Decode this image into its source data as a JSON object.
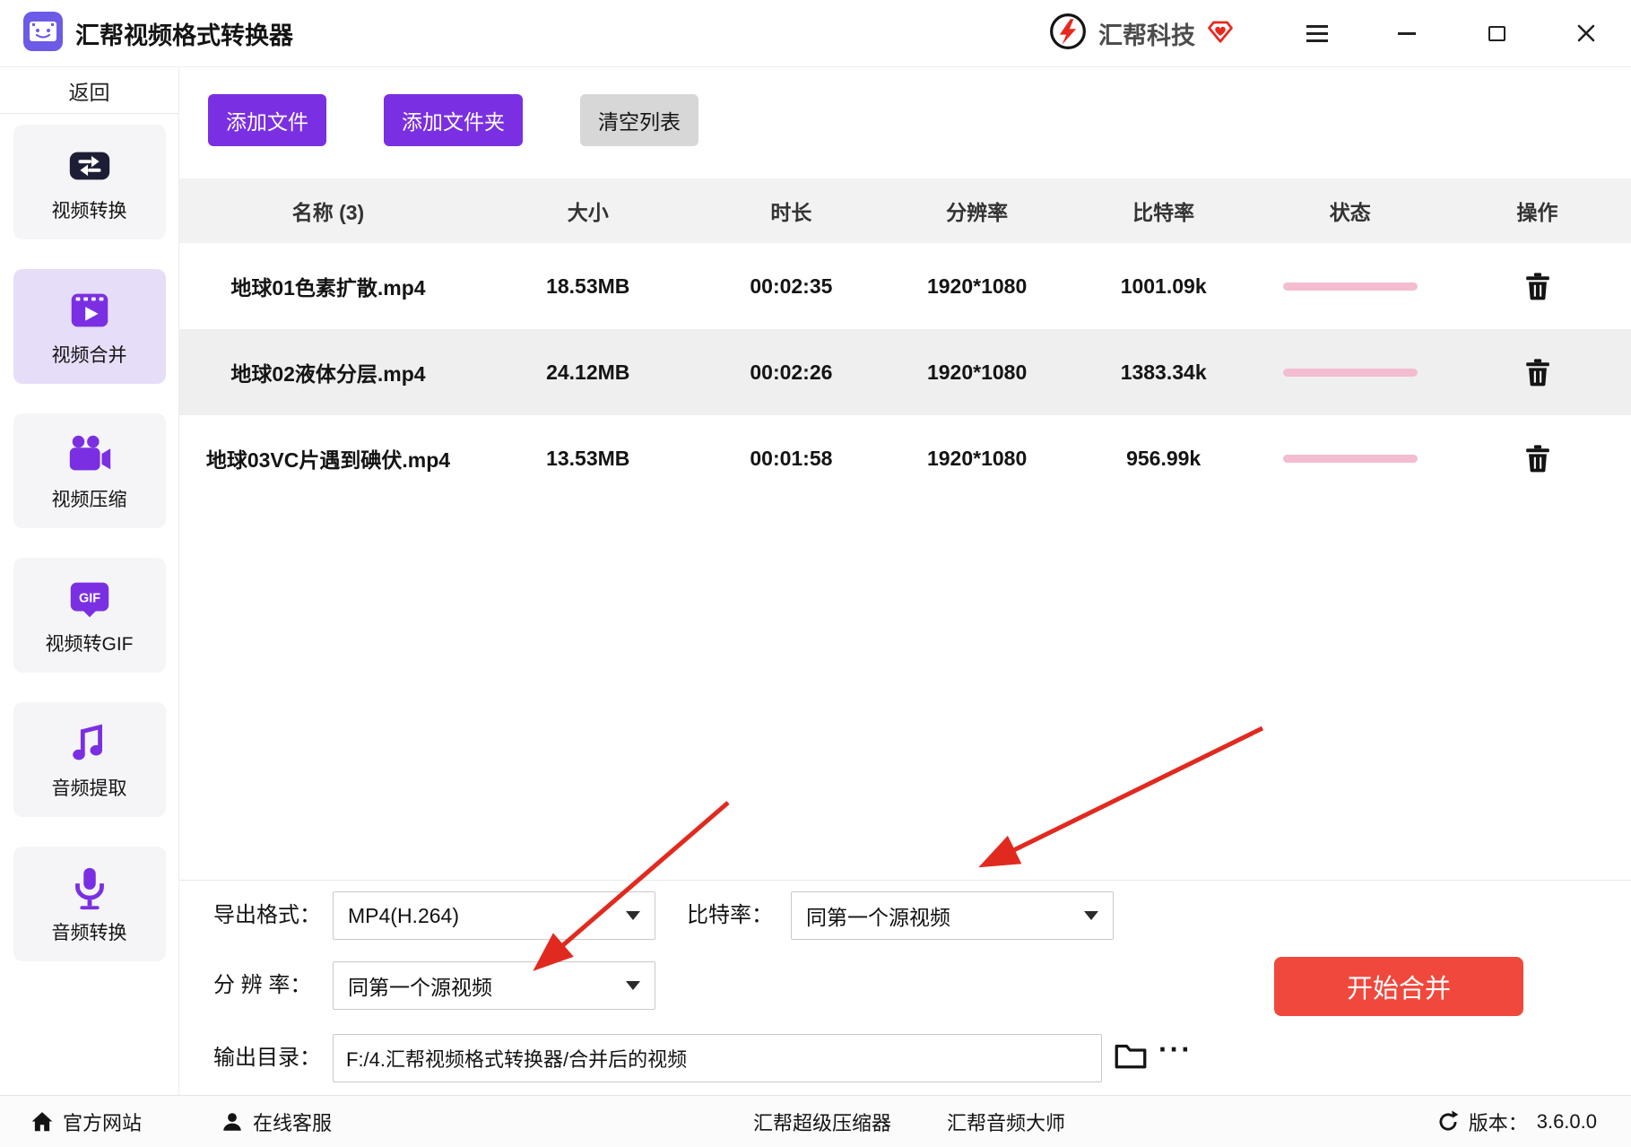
{
  "titlebar": {
    "app_title": "汇帮视频格式转换器",
    "brand_name": "汇帮科技"
  },
  "sidebar": {
    "back": "返回",
    "items": [
      {
        "label": "视频转换",
        "icon": "video-convert-icon",
        "active": false
      },
      {
        "label": "视频合并",
        "icon": "video-merge-icon",
        "active": true
      },
      {
        "label": "视频压缩",
        "icon": "video-compress-icon",
        "active": false
      },
      {
        "label": "视频转GIF",
        "icon": "video-to-gif-icon",
        "active": false
      },
      {
        "label": "音频提取",
        "icon": "audio-extract-icon",
        "active": false
      },
      {
        "label": "音频转换",
        "icon": "audio-convert-icon",
        "active": false
      }
    ]
  },
  "toolbar": {
    "add_file": "添加文件",
    "add_folder": "添加文件夹",
    "clear_list": "清空列表"
  },
  "table": {
    "headers": [
      "名称 (3)",
      "大小",
      "时长",
      "分辨率",
      "比特率",
      "状态",
      "操作"
    ],
    "rows": [
      {
        "name": "地球01色素扩散.mp4",
        "size": "18.53MB",
        "duration": "00:02:35",
        "resolution": "1920*1080",
        "bitrate": "1001.09k"
      },
      {
        "name": "地球02液体分层.mp4",
        "size": "24.12MB",
        "duration": "00:02:26",
        "resolution": "1920*1080",
        "bitrate": "1383.34k"
      },
      {
        "name": "地球03VC片遇到碘伏.mp4",
        "size": "13.53MB",
        "duration": "00:01:58",
        "resolution": "1920*1080",
        "bitrate": "956.99k"
      }
    ]
  },
  "settings": {
    "export_format": {
      "label": "导出格式：",
      "value": "MP4(H.264)"
    },
    "bitrate": {
      "label": "比特率：",
      "value": "同第一个源视频"
    },
    "resolution": {
      "label": "分 辨 率：",
      "value": "同第一个源视频"
    },
    "output_dir": {
      "label": "输出目录：",
      "value": "F:/4.汇帮视频格式转换器/合并后的视频"
    },
    "start_button": "开始合并",
    "more_button": "···"
  },
  "footer": {
    "official_site": "官方网站",
    "online_support": "在线客服",
    "super_compressor": "汇帮超级压缩器",
    "audio_master": "汇帮音频大师",
    "version_label": "版本：",
    "version_value": "3.6.0.0"
  },
  "icons": {
    "menu": "hamburger",
    "minimize": "horizontal-line",
    "maximize": "square",
    "close": "x-cross",
    "dropdown": "caret-down",
    "delete": "trash",
    "output_folder": "folder",
    "official_site": "home",
    "online_support": "person",
    "version": "refresh",
    "brand": "lightning-emblem",
    "brand_badge": "diamond-heart"
  },
  "colors": {
    "accent_purple": "#7b2fe2",
    "start_red": "#f0483c",
    "progress_pink": "#f3bcd0",
    "annotation_red": "#e12a1f"
  }
}
